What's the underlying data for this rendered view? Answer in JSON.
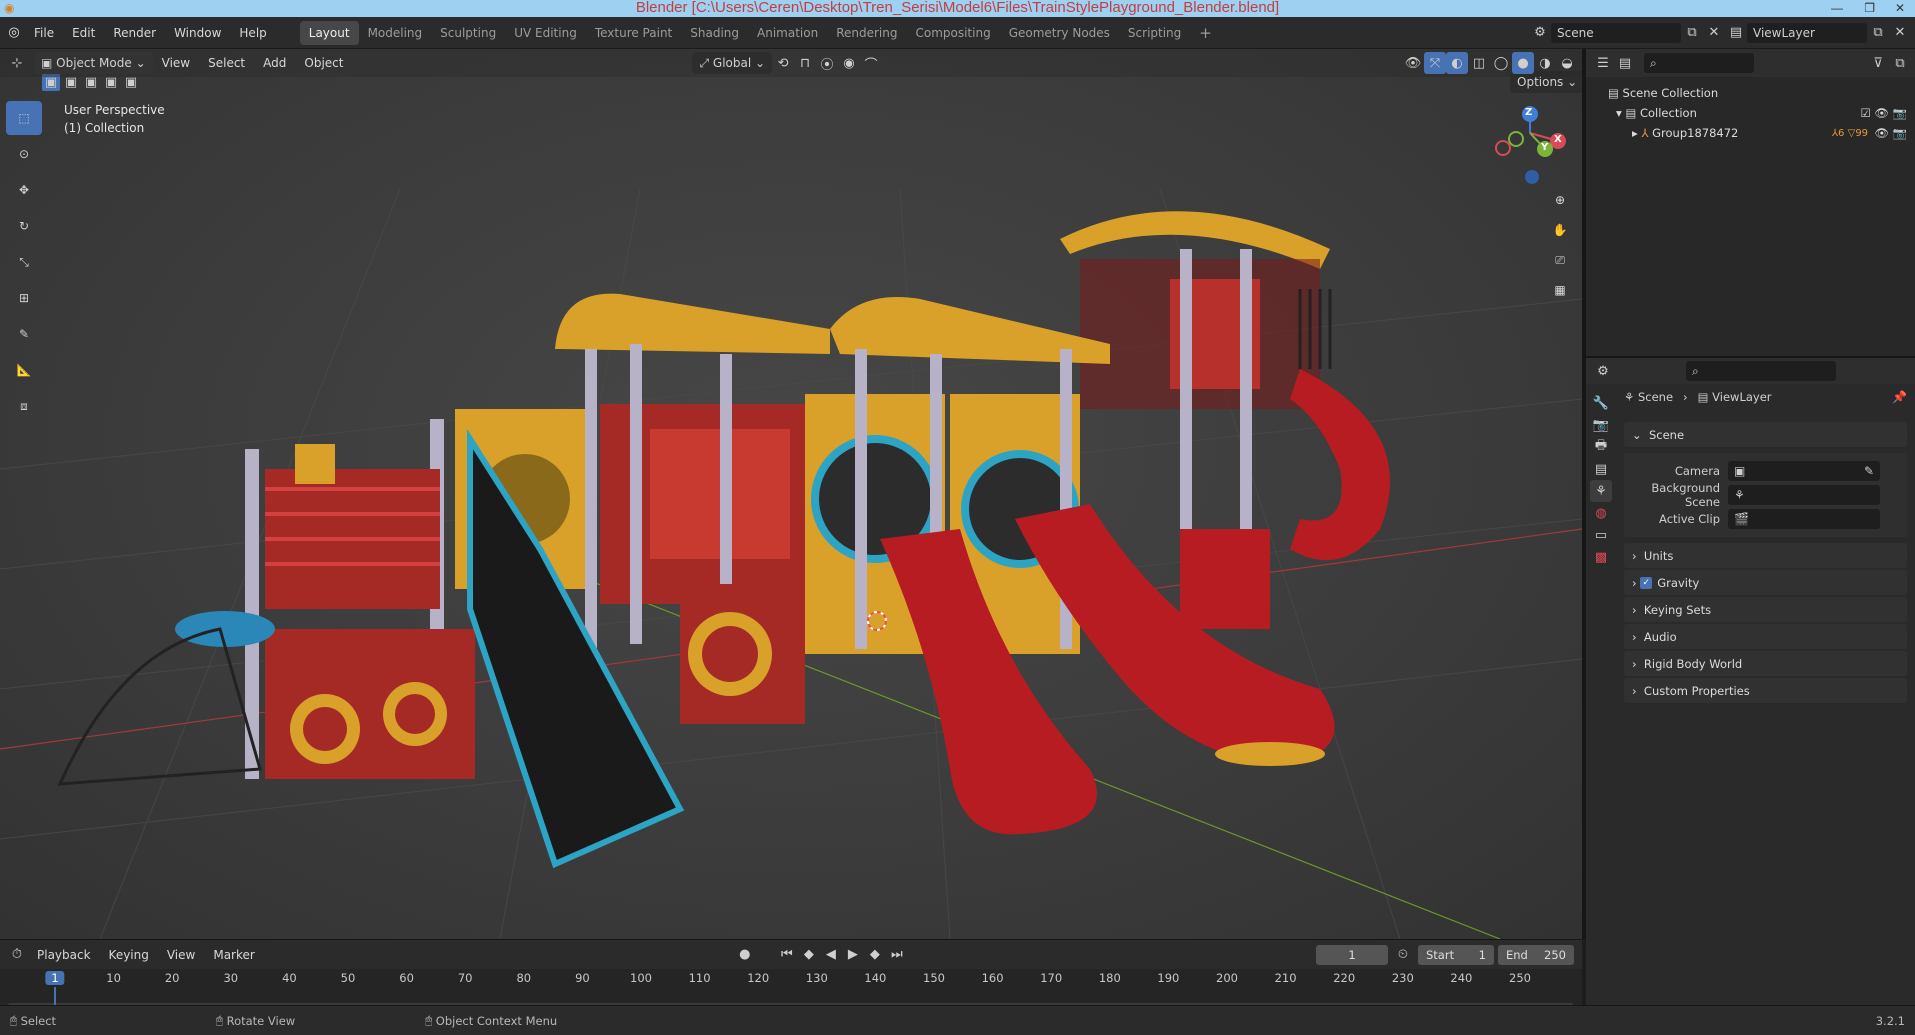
{
  "window": {
    "title": "Blender [C:\\Users\\Ceren\\Desktop\\Tren_Serisi\\Model6\\Files\\TrainStylePlayground_Blender.blend]",
    "controls": [
      "—",
      "❐",
      "✕"
    ]
  },
  "menu": {
    "items": [
      "File",
      "Edit",
      "Render",
      "Window",
      "Help"
    ],
    "workspaces": [
      "Layout",
      "Modeling",
      "Sculpting",
      "UV Editing",
      "Texture Paint",
      "Shading",
      "Animation",
      "Rendering",
      "Compositing",
      "Geometry Nodes",
      "Scripting"
    ],
    "active_workspace": "Layout",
    "add_tab": "+",
    "scene": "Scene",
    "view_layer": "ViewLayer"
  },
  "viewport": {
    "mode": "Object Mode",
    "menus": [
      "View",
      "Select",
      "Add",
      "Object"
    ],
    "orientation": "Global",
    "options_label": "Options",
    "overlay_line1": "User Perspective",
    "overlay_line2": "(1) Collection",
    "gizmo": {
      "x": "X",
      "y": "Y",
      "z": "Z"
    }
  },
  "outliner": {
    "scene_collection": "Scene Collection",
    "collection": "Collection",
    "object": "Group1878472",
    "badge1": "6",
    "badge2": "99"
  },
  "properties": {
    "breadcrumb_scene": "Scene",
    "breadcrumb_sep": "›",
    "breadcrumb_layer": "ViewLayer",
    "section": "Scene",
    "camera_label": "Camera",
    "background_scene_label": "Background Scene",
    "active_clip_label": "Active Clip",
    "subsections": [
      "Units",
      "Gravity",
      "Keying Sets",
      "Audio",
      "Rigid Body World",
      "Custom Properties"
    ],
    "gravity_checked": true
  },
  "timeline": {
    "menus": [
      "Playback",
      "Keying",
      "View",
      "Marker"
    ],
    "current_frame": "1",
    "start_label": "Start",
    "start": "1",
    "end_label": "End",
    "end": "250",
    "ticks": [
      "1",
      "10",
      "20",
      "30",
      "40",
      "50",
      "60",
      "70",
      "80",
      "90",
      "100",
      "110",
      "120",
      "130",
      "140",
      "150",
      "160",
      "170",
      "180",
      "190",
      "200",
      "210",
      "220",
      "230",
      "240",
      "250"
    ]
  },
  "status": {
    "select": "Select",
    "rotate": "Rotate View",
    "context": "Object Context Menu",
    "version": "3.2.1"
  },
  "colors": {
    "accent": "#4772b3",
    "x_axis": "#d94a57",
    "y_axis": "#7ab53a",
    "z_axis": "#3f7fd8"
  }
}
